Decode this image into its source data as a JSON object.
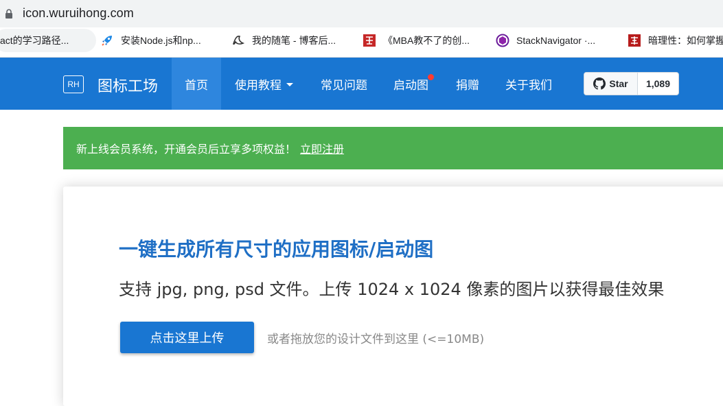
{
  "browser": {
    "url": "icon.wuruihong.com",
    "bookmarks": [
      {
        "label": "act的学习路径...",
        "icon": "bookmark-icon"
      },
      {
        "label": "安装Node.js和np...",
        "icon": "rocket-icon"
      },
      {
        "label": "我的随笔 - 博客后...",
        "icon": "pen-icon"
      },
      {
        "label": "《MBA教不了的创...",
        "icon": "red-seal-icon"
      },
      {
        "label": "StackNavigator ·...",
        "icon": "hexagon-icon"
      },
      {
        "label": "暗理性：如何掌握",
        "icon": "red-seal-icon"
      }
    ]
  },
  "navbar": {
    "logo": "RH",
    "brand": "图标工场",
    "items": [
      {
        "label": "首页"
      },
      {
        "label": "使用教程"
      },
      {
        "label": "常见问题"
      },
      {
        "label": "启动图"
      },
      {
        "label": "捐赠"
      },
      {
        "label": "关于我们"
      }
    ],
    "github": {
      "star_label": "Star",
      "count": "1,089"
    }
  },
  "banner": {
    "text": "新上线会员系统，开通会员后立享多项权益！",
    "link": "立即注册"
  },
  "main": {
    "headline": "一键生成所有尺寸的应用图标/启动图",
    "subline": "支持 jpg, png, psd 文件。上传 1024 x 1024 像素的图片以获得最佳效果",
    "upload_button": "点击这里上传",
    "drag_hint": "或者拖放您的设计文件到这里 (<=10MB)"
  },
  "colors": {
    "navbar": "#1976d2",
    "nav_active": "#2e86de",
    "banner": "#4caf50",
    "headline": "#1f6fc5",
    "notification_dot": "#ff3b30"
  }
}
